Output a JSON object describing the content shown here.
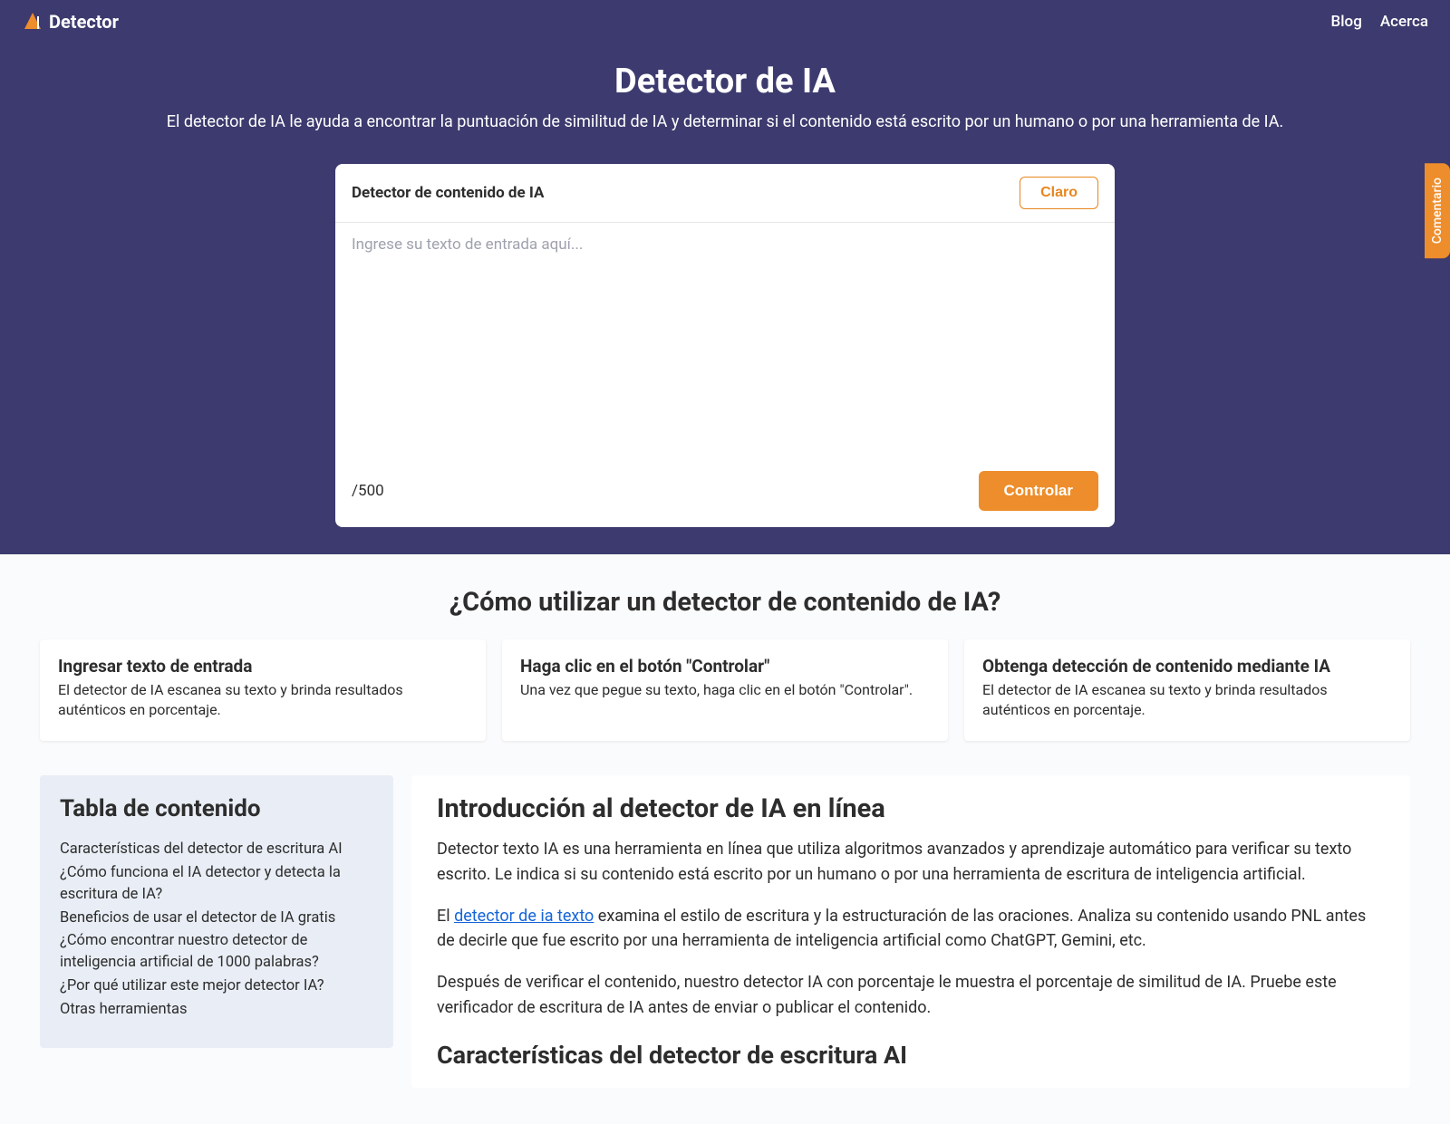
{
  "nav": {
    "blog": "Blog",
    "about": "Acerca"
  },
  "logo": {
    "text": "Detector"
  },
  "hero": {
    "title": "Detector de IA",
    "subtitle": "El detector de IA le ayuda a encontrar la puntuación de similitud de IA y determinar si el contenido está escrito por un humano o por una herramienta de IA."
  },
  "card": {
    "title": "Detector de contenido de IA",
    "clear": "Claro",
    "placeholder": "Ingrese su texto de entrada aquí...",
    "counter": "/500",
    "check": "Controlar"
  },
  "feedback": "Comentario",
  "howto": {
    "title": "¿Cómo utilizar un detector de contenido de IA?",
    "steps": [
      {
        "title": "Ingresar texto de entrada",
        "desc": "El detector de IA escanea su texto y brinda resultados auténticos en porcentaje."
      },
      {
        "title": "Haga clic en el botón \"Controlar\"",
        "desc": "Una vez que pegue su texto, haga clic en el botón \"Controlar\"."
      },
      {
        "title": "Obtenga detección de contenido mediante IA",
        "desc": "El detector de IA escanea su texto y brinda resultados auténticos en porcentaje."
      }
    ]
  },
  "toc": {
    "title": "Tabla de contenido",
    "items": [
      "Características del detector de escritura AI",
      "¿Cómo funciona el IA detector y detecta la escritura de IA?",
      "Beneficios de usar el detector de IA gratis",
      "¿Cómo encontrar nuestro detector de inteligencia artificial de 1000 palabras?",
      "¿Por qué utilizar este mejor detector IA?",
      "Otras herramientas"
    ]
  },
  "article": {
    "h2": "Introducción al detector de IA en línea",
    "p1": "Detector texto IA es una herramienta en línea que utiliza algoritmos avanzados y aprendizaje automático para verificar su texto escrito. Le indica si su contenido está escrito por un humano o por una herramienta de escritura de inteligencia artificial.",
    "p2a": "El ",
    "p2link": "detector de ia texto",
    "p2b": " examina el estilo de escritura y la estructuración de las oraciones. Analiza su contenido usando PNL antes de decirle que fue escrito por una herramienta de inteligencia artificial como ChatGPT, Gemini, etc.",
    "p3": "Después de verificar el contenido, nuestro detector IA con porcentaje le muestra el porcentaje de similitud de IA. Pruebe este verificador de escritura de IA antes de enviar o publicar el contenido.",
    "h3": "Características del detector de escritura AI"
  }
}
